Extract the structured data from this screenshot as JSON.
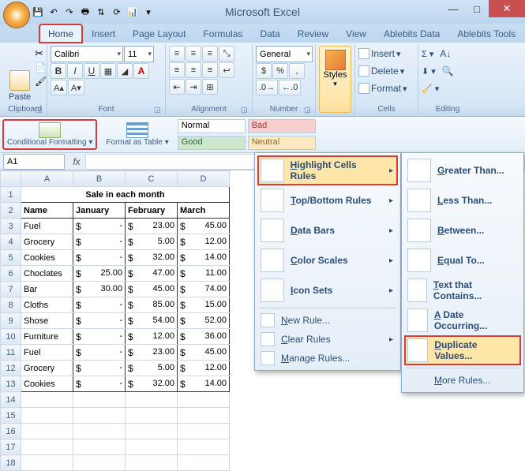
{
  "app": {
    "title": "Microsoft Excel"
  },
  "qat": [
    "save",
    "undo",
    "redo",
    "print",
    "sort",
    "refresh",
    "chart"
  ],
  "winbuttons": {
    "min": "—",
    "max": "□",
    "close": "✕"
  },
  "tabs": [
    "Home",
    "Insert",
    "Page Layout",
    "Formulas",
    "Data",
    "Review",
    "View",
    "Ablebits Data",
    "Ablebits Tools"
  ],
  "active_tab": 0,
  "ribbon": {
    "clipboard": {
      "label": "Clipboard",
      "paste": "Paste"
    },
    "font": {
      "label": "Font",
      "face": "Calibri",
      "size": "11"
    },
    "alignment": {
      "label": "Alignment"
    },
    "number": {
      "label": "Number",
      "format": "General"
    },
    "styles": {
      "label": "Styles"
    },
    "cells": {
      "label": "Cells",
      "insert": "Insert",
      "delete": "Delete",
      "format": "Format"
    },
    "editing": {
      "label": "Editing"
    }
  },
  "gallery": {
    "cond": "Conditional Formatting ▾",
    "fmt": "Format as Table ▾",
    "normal": "Normal",
    "bad": "Bad",
    "good": "Good",
    "neutral": "Neutral"
  },
  "namebox": "A1",
  "columns": [
    "A",
    "B",
    "C",
    "D"
  ],
  "sheet": {
    "title": "Sale in each month",
    "headers": [
      "Name",
      "January",
      "February",
      "March"
    ],
    "rows": [
      {
        "name": "Fuel",
        "jan": "-",
        "feb": "23.00",
        "mar": "45.00"
      },
      {
        "name": "Grocery",
        "jan": "-",
        "feb": "5.00",
        "mar": "12.00"
      },
      {
        "name": "Cookies",
        "jan": "-",
        "feb": "32.00",
        "mar": "14.00"
      },
      {
        "name": "Choclates",
        "jan": "25.00",
        "feb": "47.00",
        "mar": "11.00"
      },
      {
        "name": "Bar",
        "jan": "30.00",
        "feb": "45.00",
        "mar": "74.00"
      },
      {
        "name": "Cloths",
        "jan": "-",
        "feb": "85.00",
        "mar": "15.00"
      },
      {
        "name": "Shose",
        "jan": "-",
        "feb": "54.00",
        "mar": "52.00"
      },
      {
        "name": "Furniture",
        "jan": "-",
        "feb": "12.00",
        "mar": "36.00"
      },
      {
        "name": "Fuel",
        "jan": "-",
        "feb": "23.00",
        "mar": "45.00"
      },
      {
        "name": "Grocery",
        "jan": "-",
        "feb": "5.00",
        "mar": "12.00"
      },
      {
        "name": "Cookies",
        "jan": "-",
        "feb": "32.00",
        "mar": "14.00"
      }
    ],
    "blank_rows": 5,
    "currency": "$"
  },
  "menu1": {
    "items": [
      {
        "label": "Highlight Cells Rules",
        "hl": true,
        "sub": true
      },
      {
        "label": "Top/Bottom Rules",
        "sub": true
      },
      {
        "label": "Data Bars",
        "sub": true
      },
      {
        "label": "Color Scales",
        "sub": true
      },
      {
        "label": "Icon Sets",
        "sub": true
      }
    ],
    "small": [
      {
        "label": "New Rule..."
      },
      {
        "label": "Clear Rules",
        "sub": true
      },
      {
        "label": "Manage Rules..."
      }
    ]
  },
  "menu2": {
    "items": [
      {
        "label": "Greater Than..."
      },
      {
        "label": "Less Than..."
      },
      {
        "label": "Between..."
      },
      {
        "label": "Equal To..."
      },
      {
        "label": "Text that Contains..."
      },
      {
        "label": "A Date Occurring..."
      },
      {
        "label": "Duplicate Values...",
        "hl": true
      }
    ],
    "more": "More Rules..."
  }
}
